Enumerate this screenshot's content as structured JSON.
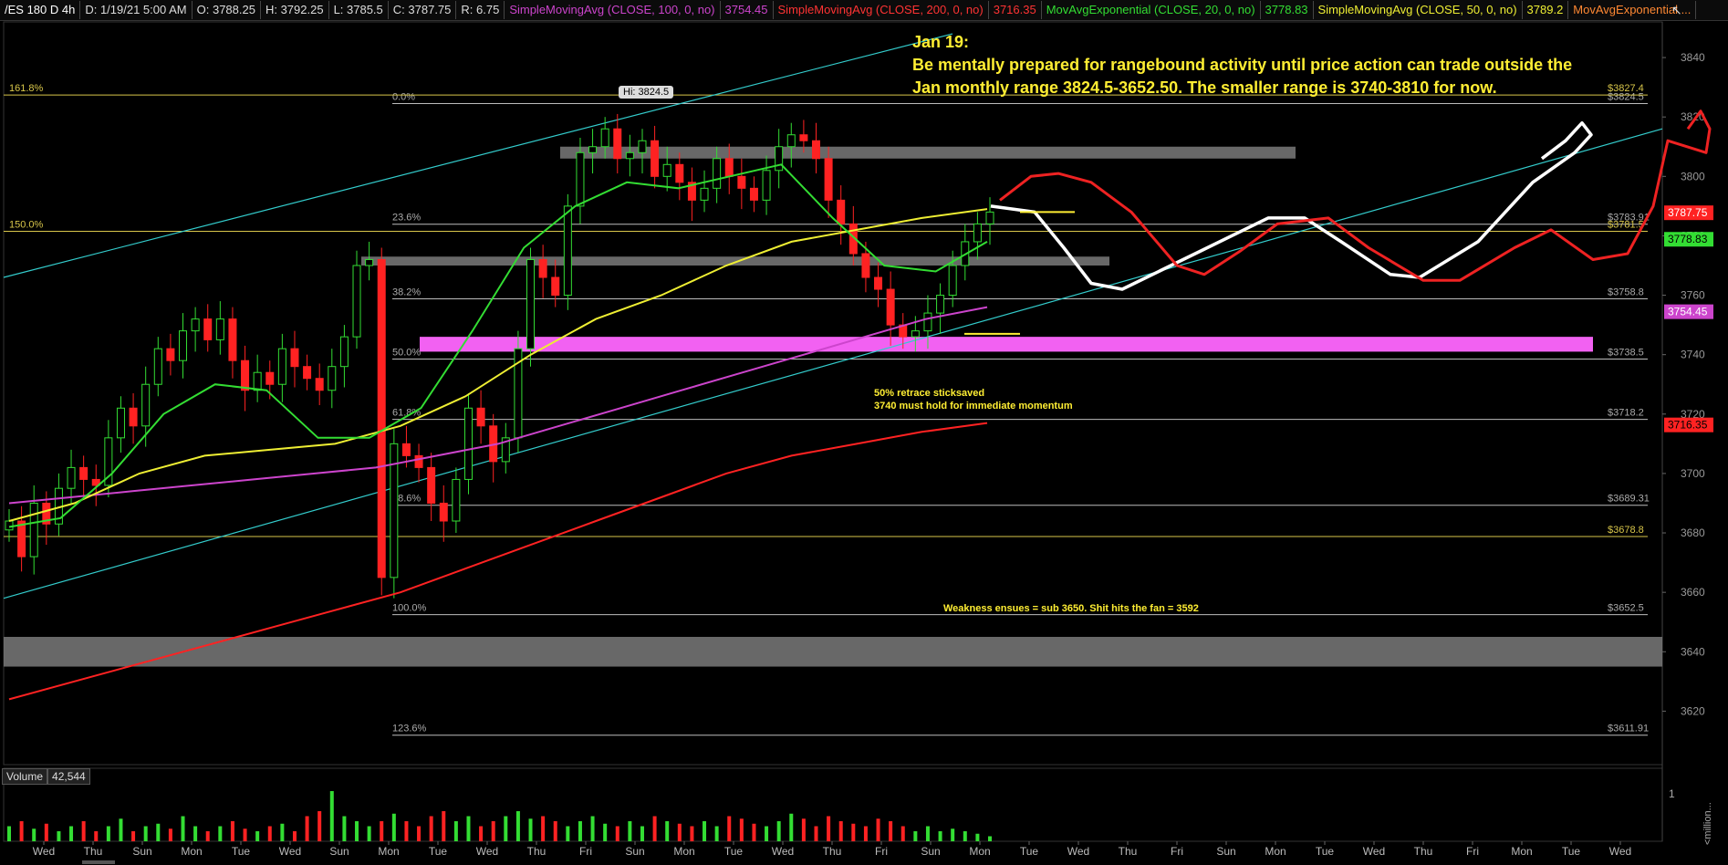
{
  "header": {
    "items": [
      {
        "text": "/ES 180 D 4h",
        "color": "#ffffff"
      },
      {
        "text": "D: 1/19/21 5:00 AM",
        "color": "#dddddd"
      },
      {
        "text": "O: 3788.25",
        "color": "#dddddd"
      },
      {
        "text": "H: 3792.25",
        "color": "#dddddd"
      },
      {
        "text": "L: 3785.5",
        "color": "#dddddd"
      },
      {
        "text": "C: 3787.75",
        "color": "#dddddd"
      },
      {
        "text": "R: 6.75",
        "color": "#dddddd"
      },
      {
        "text": "SimpleMovingAvg (CLOSE, 100, 0, no)",
        "color": "#cc44cc"
      },
      {
        "text": "3754.45",
        "color": "#cc44cc"
      },
      {
        "text": "SimpleMovingAvg (CLOSE, 200, 0, no)",
        "color": "#ff3333"
      },
      {
        "text": "3716.35",
        "color": "#ff3333"
      },
      {
        "text": "MovAvgExponential (CLOSE, 20, 0, no)",
        "color": "#33dd33"
      },
      {
        "text": "3778.83",
        "color": "#33dd33"
      },
      {
        "text": "SimpleMovingAvg (CLOSE, 50, 0, no)",
        "color": "#eeee33"
      },
      {
        "text": "3789.2",
        "color": "#eeee33"
      },
      {
        "text": "MovAvgExponential ...",
        "color": "#ff8833"
      }
    ]
  },
  "note": {
    "lines": [
      "Jan 19:",
      "Be mentally prepared for rangebound activity until price action can trade outside the",
      "Jan monthly range 3824.5-3652.50. The smaller range is 3740-3810 for now."
    ]
  },
  "annotations": {
    "retrace_line1": "50%  retrace sticksaved",
    "retrace_line2": "3740 must hold for immediate momentum",
    "weakness": "Weakness ensues = sub 3650. Shit hits the fan = 3592",
    "hi_label": "Hi: 3824.5"
  },
  "volume_panel": {
    "label": "Volume",
    "value": "42,544",
    "axis_tick": "1",
    "axis_unit": "<million..."
  },
  "colors": {
    "up": "#33dd33",
    "down": "#ff2222",
    "sma100": "#cc44cc",
    "sma200": "#ff2222",
    "ema20": "#33dd33",
    "sma50": "#eeee33",
    "ema_orange": "#ff8833",
    "fib": "#c8b84a",
    "zone_gray": "#7a7a7a",
    "zone_pink": "#ff66ff",
    "channel": "#33cccc"
  },
  "chart_data": {
    "type": "candlestick",
    "title": "/ES 180 D 4h",
    "ylim": [
      3602,
      3852
    ],
    "y_ticks": [
      3620,
      3640,
      3660,
      3680,
      3700,
      3720,
      3740,
      3760,
      3780,
      3800,
      3820,
      3840
    ],
    "x_ticks": [
      "Wed",
      "Thu",
      "Sun",
      "Mon",
      "Tue",
      "Wed",
      "Sun",
      "Mon",
      "Tue",
      "Wed",
      "Thu",
      "Fri",
      "Sun",
      "Mon",
      "Tue",
      "Wed",
      "Thu",
      "Fri",
      "Sun",
      "Mon",
      "Tue",
      "Wed",
      "Thu",
      "Fri",
      "Sun",
      "Mon",
      "Tue",
      "Wed",
      "Thu",
      "Fri",
      "Mon",
      "Tue",
      "Wed"
    ],
    "closes": [
      3684,
      3672,
      3690,
      3683,
      3695,
      3702,
      3698,
      3696,
      3712,
      3722,
      3716,
      3730,
      3742,
      3738,
      3748,
      3752,
      3745,
      3752,
      3738,
      3728,
      3734,
      3730,
      3742,
      3736,
      3732,
      3728,
      3736,
      3746,
      3770,
      3772,
      3665,
      3710,
      3706,
      3702,
      3690,
      3684,
      3698,
      3722,
      3716,
      3704,
      3712,
      3742,
      3772,
      3766,
      3760,
      3790,
      3808,
      3810,
      3816,
      3806,
      3808,
      3812,
      3800,
      3804,
      3798,
      3792,
      3796,
      3806,
      3800,
      3796,
      3792,
      3802,
      3810,
      3814,
      3812,
      3806,
      3792,
      3784,
      3774,
      3766,
      3762,
      3750,
      3746,
      3748,
      3754,
      3760,
      3770,
      3778,
      3784,
      3788
    ],
    "series": [
      {
        "name": "SimpleMovingAvg (CLOSE, 100, 0, no)",
        "last": 3754.45,
        "values": [
          3690,
          3692,
          3694,
          3696,
          3698,
          3700,
          3702,
          3706,
          3710,
          3716,
          3722,
          3728,
          3734,
          3740,
          3746,
          3752,
          3756
        ]
      },
      {
        "name": "SimpleMovingAvg (CLOSE, 200, 0, no)",
        "last": 3716.35,
        "values": [
          3624,
          3630,
          3636,
          3642,
          3648,
          3654,
          3660,
          3668,
          3676,
          3684,
          3692,
          3700,
          3706,
          3710,
          3714,
          3717
        ]
      },
      {
        "name": "MovAvgExponential (CLOSE, 20, 0, no)",
        "last": 3778.83,
        "values": [
          3682,
          3685,
          3700,
          3720,
          3730,
          3728,
          3712,
          3712,
          3722,
          3748,
          3776,
          3790,
          3798,
          3796,
          3800,
          3804,
          3786,
          3770,
          3768,
          3778
        ]
      },
      {
        "name": "SimpleMovingAvg (CLOSE, 50, 0, no)",
        "last": 3789.2,
        "values": [
          3684,
          3690,
          3700,
          3706,
          3708,
          3710,
          3716,
          3726,
          3740,
          3752,
          3760,
          3770,
          3778,
          3782,
          3786,
          3789
        ]
      }
    ],
    "fibonacci": [
      {
        "label": "0.0%",
        "value": "3824.5"
      },
      {
        "label": "23.6%",
        "value": "3783.91"
      },
      {
        "label": "38.2%",
        "value": "3758.8"
      },
      {
        "label": "50.0%",
        "value": "3738.5"
      },
      {
        "label": "61.8%",
        "value": "3718.2"
      },
      {
        "label": "78.6%",
        "value": "3689.31"
      },
      {
        "label": "100.0%",
        "value": "3652.5"
      },
      {
        "label": "123.6%",
        "value": "3611.91"
      },
      {
        "label": "161.8%",
        "value": "3827.4"
      },
      {
        "label": "150.0%",
        "value": "3781.5"
      }
    ],
    "extra_levels": [
      {
        "value": "3678.8"
      }
    ],
    "price_tags": [
      {
        "value": "3787.75",
        "bg": "#ff2222",
        "fg": "#ffffff"
      },
      {
        "value": "3778.83",
        "bg": "#33dd33",
        "fg": "#000000"
      },
      {
        "value": "3754.45",
        "bg": "#cc44cc",
        "fg": "#ffffff"
      },
      {
        "value": "3716.35",
        "bg": "#ff2222",
        "fg": "#000000"
      }
    ],
    "zones": [
      {
        "color": "gray",
        "from": 3806,
        "to": 3810
      },
      {
        "color": "gray",
        "from": 3770,
        "to": 3773
      },
      {
        "color": "pink",
        "from": 3741,
        "to": 3746
      },
      {
        "color": "gray",
        "from": 3635,
        "to": 3645
      }
    ],
    "volume": [
      0.3,
      0.4,
      0.25,
      0.35,
      0.2,
      0.3,
      0.4,
      0.2,
      0.3,
      0.45,
      0.2,
      0.3,
      0.35,
      0.25,
      0.5,
      0.3,
      0.2,
      0.3,
      0.4,
      0.25,
      0.2,
      0.3,
      0.35,
      0.2,
      0.5,
      0.6,
      1.0,
      0.5,
      0.4,
      0.3,
      0.4,
      0.55,
      0.4,
      0.3,
      0.5,
      0.6,
      0.4,
      0.5,
      0.3,
      0.4,
      0.5,
      0.6,
      0.45,
      0.5,
      0.4,
      0.3,
      0.4,
      0.5,
      0.35,
      0.3,
      0.4,
      0.3,
      0.5,
      0.4,
      0.35,
      0.3,
      0.4,
      0.3,
      0.5,
      0.45,
      0.35,
      0.3,
      0.4,
      0.55,
      0.45,
      0.3,
      0.5,
      0.4,
      0.35,
      0.3,
      0.45,
      0.4,
      0.3,
      0.2,
      0.3,
      0.2,
      0.25,
      0.2,
      0.15,
      0.1
    ]
  }
}
